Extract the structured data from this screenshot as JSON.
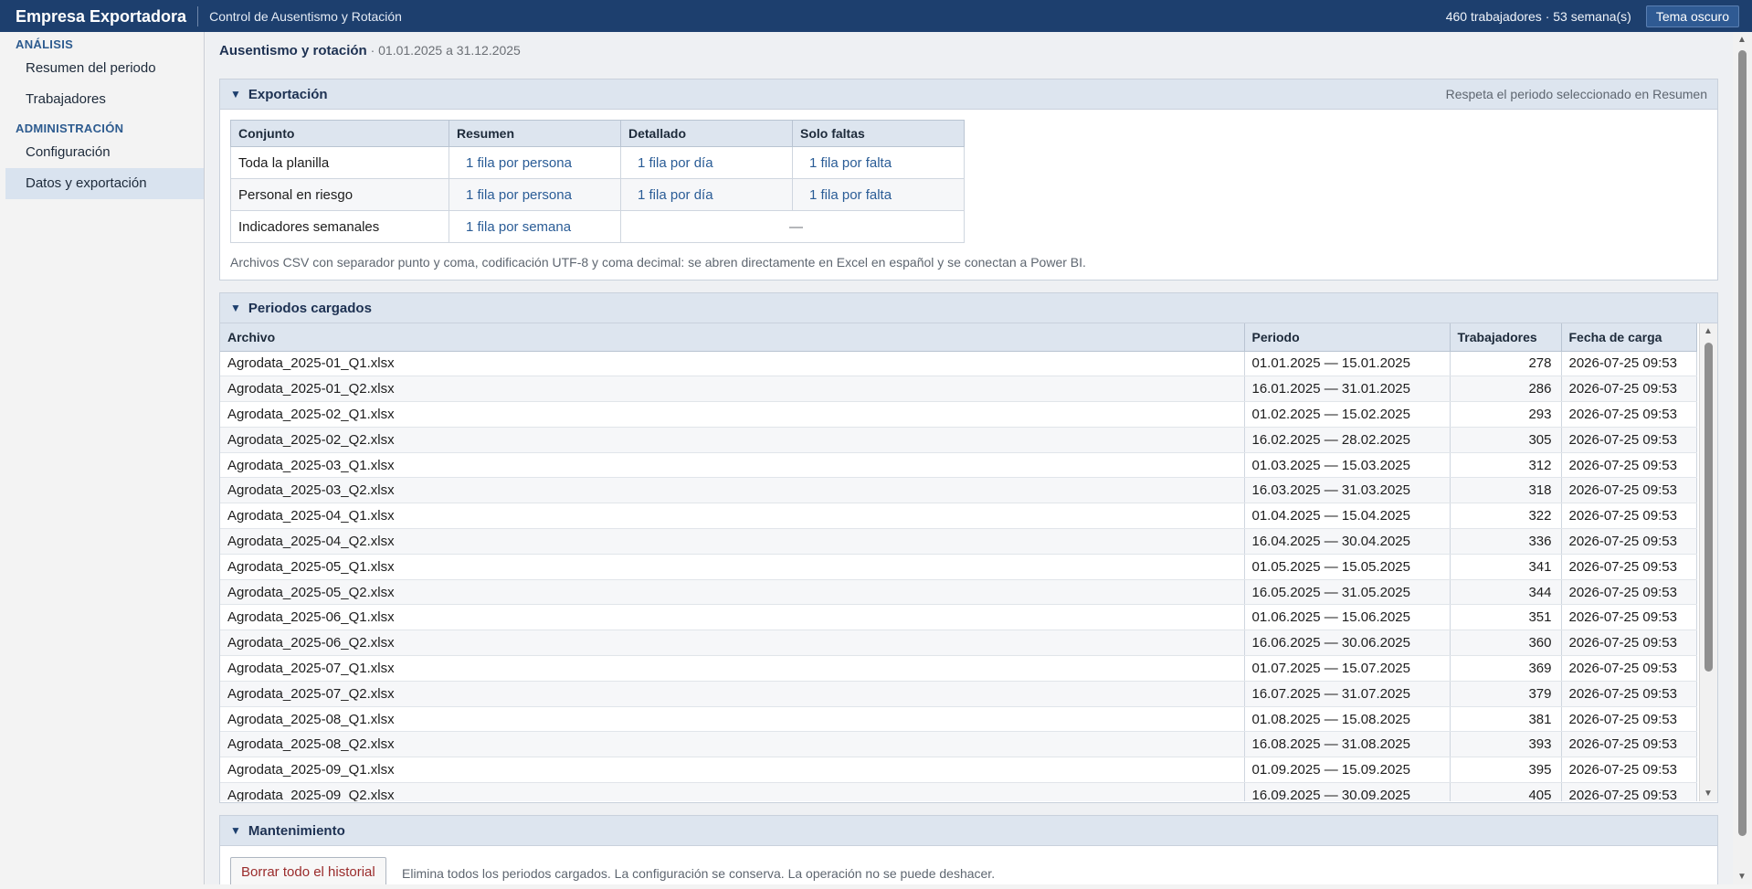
{
  "topbar": {
    "title": "Empresa Exportadora",
    "subtitle": "Control de Ausentismo y Rotación",
    "stats": "460 trabajadores · 53 semana(s)",
    "theme_button": "Tema oscuro"
  },
  "sidebar": {
    "sections": [
      {
        "title": "ANÁLISIS",
        "items": [
          {
            "label": "Resumen del periodo"
          },
          {
            "label": "Trabajadores"
          }
        ]
      },
      {
        "title": "ADMINISTRACIÓN",
        "items": [
          {
            "label": "Configuración"
          },
          {
            "label": "Datos y exportación",
            "active": true
          }
        ]
      }
    ]
  },
  "page": {
    "title": "Ausentismo y rotación",
    "range": " · 01.01.2025 a 31.12.2025"
  },
  "export_panel": {
    "title": "Exportación",
    "note": "Respeta el periodo seleccionado en Resumen",
    "headers": [
      "Conjunto",
      "Resumen",
      "Detallado",
      "Solo faltas"
    ],
    "rows": [
      {
        "set": "Toda la planilla",
        "summary": "1 fila por persona",
        "detail": "1 fila por día",
        "absences": "1 fila por falta"
      },
      {
        "set": "Personal en riesgo",
        "summary": "1 fila por persona",
        "detail": "1 fila por día",
        "absences": "1 fila por falta"
      },
      {
        "set": "Indicadores semanales",
        "summary": "1 fila por semana",
        "dash": "—"
      }
    ],
    "footnote": "Archivos CSV con separador punto y coma, codificación UTF-8 y coma decimal: se abren directamente en Excel en español y se conectan a Power BI."
  },
  "periods_panel": {
    "title": "Periodos cargados",
    "headers": [
      "Archivo",
      "Periodo",
      "Trabajadores",
      "Fecha de carga"
    ],
    "rows": [
      {
        "file": "Agrodata_2025-01_Q1.xlsx",
        "period": "01.01.2025 — 15.01.2025",
        "workers": "278",
        "loaded": "2026-07-25 09:53"
      },
      {
        "file": "Agrodata_2025-01_Q2.xlsx",
        "period": "16.01.2025 — 31.01.2025",
        "workers": "286",
        "loaded": "2026-07-25 09:53"
      },
      {
        "file": "Agrodata_2025-02_Q1.xlsx",
        "period": "01.02.2025 — 15.02.2025",
        "workers": "293",
        "loaded": "2026-07-25 09:53"
      },
      {
        "file": "Agrodata_2025-02_Q2.xlsx",
        "period": "16.02.2025 — 28.02.2025",
        "workers": "305",
        "loaded": "2026-07-25 09:53"
      },
      {
        "file": "Agrodata_2025-03_Q1.xlsx",
        "period": "01.03.2025 — 15.03.2025",
        "workers": "312",
        "loaded": "2026-07-25 09:53"
      },
      {
        "file": "Agrodata_2025-03_Q2.xlsx",
        "period": "16.03.2025 — 31.03.2025",
        "workers": "318",
        "loaded": "2026-07-25 09:53"
      },
      {
        "file": "Agrodata_2025-04_Q1.xlsx",
        "period": "01.04.2025 — 15.04.2025",
        "workers": "322",
        "loaded": "2026-07-25 09:53"
      },
      {
        "file": "Agrodata_2025-04_Q2.xlsx",
        "period": "16.04.2025 — 30.04.2025",
        "workers": "336",
        "loaded": "2026-07-25 09:53"
      },
      {
        "file": "Agrodata_2025-05_Q1.xlsx",
        "period": "01.05.2025 — 15.05.2025",
        "workers": "341",
        "loaded": "2026-07-25 09:53"
      },
      {
        "file": "Agrodata_2025-05_Q2.xlsx",
        "period": "16.05.2025 — 31.05.2025",
        "workers": "344",
        "loaded": "2026-07-25 09:53"
      },
      {
        "file": "Agrodata_2025-06_Q1.xlsx",
        "period": "01.06.2025 — 15.06.2025",
        "workers": "351",
        "loaded": "2026-07-25 09:53"
      },
      {
        "file": "Agrodata_2025-06_Q2.xlsx",
        "period": "16.06.2025 — 30.06.2025",
        "workers": "360",
        "loaded": "2026-07-25 09:53"
      },
      {
        "file": "Agrodata_2025-07_Q1.xlsx",
        "period": "01.07.2025 — 15.07.2025",
        "workers": "369",
        "loaded": "2026-07-25 09:53"
      },
      {
        "file": "Agrodata_2025-07_Q2.xlsx",
        "period": "16.07.2025 — 31.07.2025",
        "workers": "379",
        "loaded": "2026-07-25 09:53"
      },
      {
        "file": "Agrodata_2025-08_Q1.xlsx",
        "period": "01.08.2025 — 15.08.2025",
        "workers": "381",
        "loaded": "2026-07-25 09:53"
      },
      {
        "file": "Agrodata_2025-08_Q2.xlsx",
        "period": "16.08.2025 — 31.08.2025",
        "workers": "393",
        "loaded": "2026-07-25 09:53"
      },
      {
        "file": "Agrodata_2025-09_Q1.xlsx",
        "period": "01.09.2025 — 15.09.2025",
        "workers": "395",
        "loaded": "2026-07-25 09:53"
      },
      {
        "file": "Agrodata_2025-09_Q2.xlsx",
        "period": "16.09.2025 — 30.09.2025",
        "workers": "405",
        "loaded": "2026-07-25 09:53"
      }
    ]
  },
  "maintenance_panel": {
    "title": "Mantenimiento",
    "button": "Borrar todo el historial",
    "note": "Elimina todos los periodos cargados. La configuración se conserva. La operación no se puede deshacer."
  }
}
